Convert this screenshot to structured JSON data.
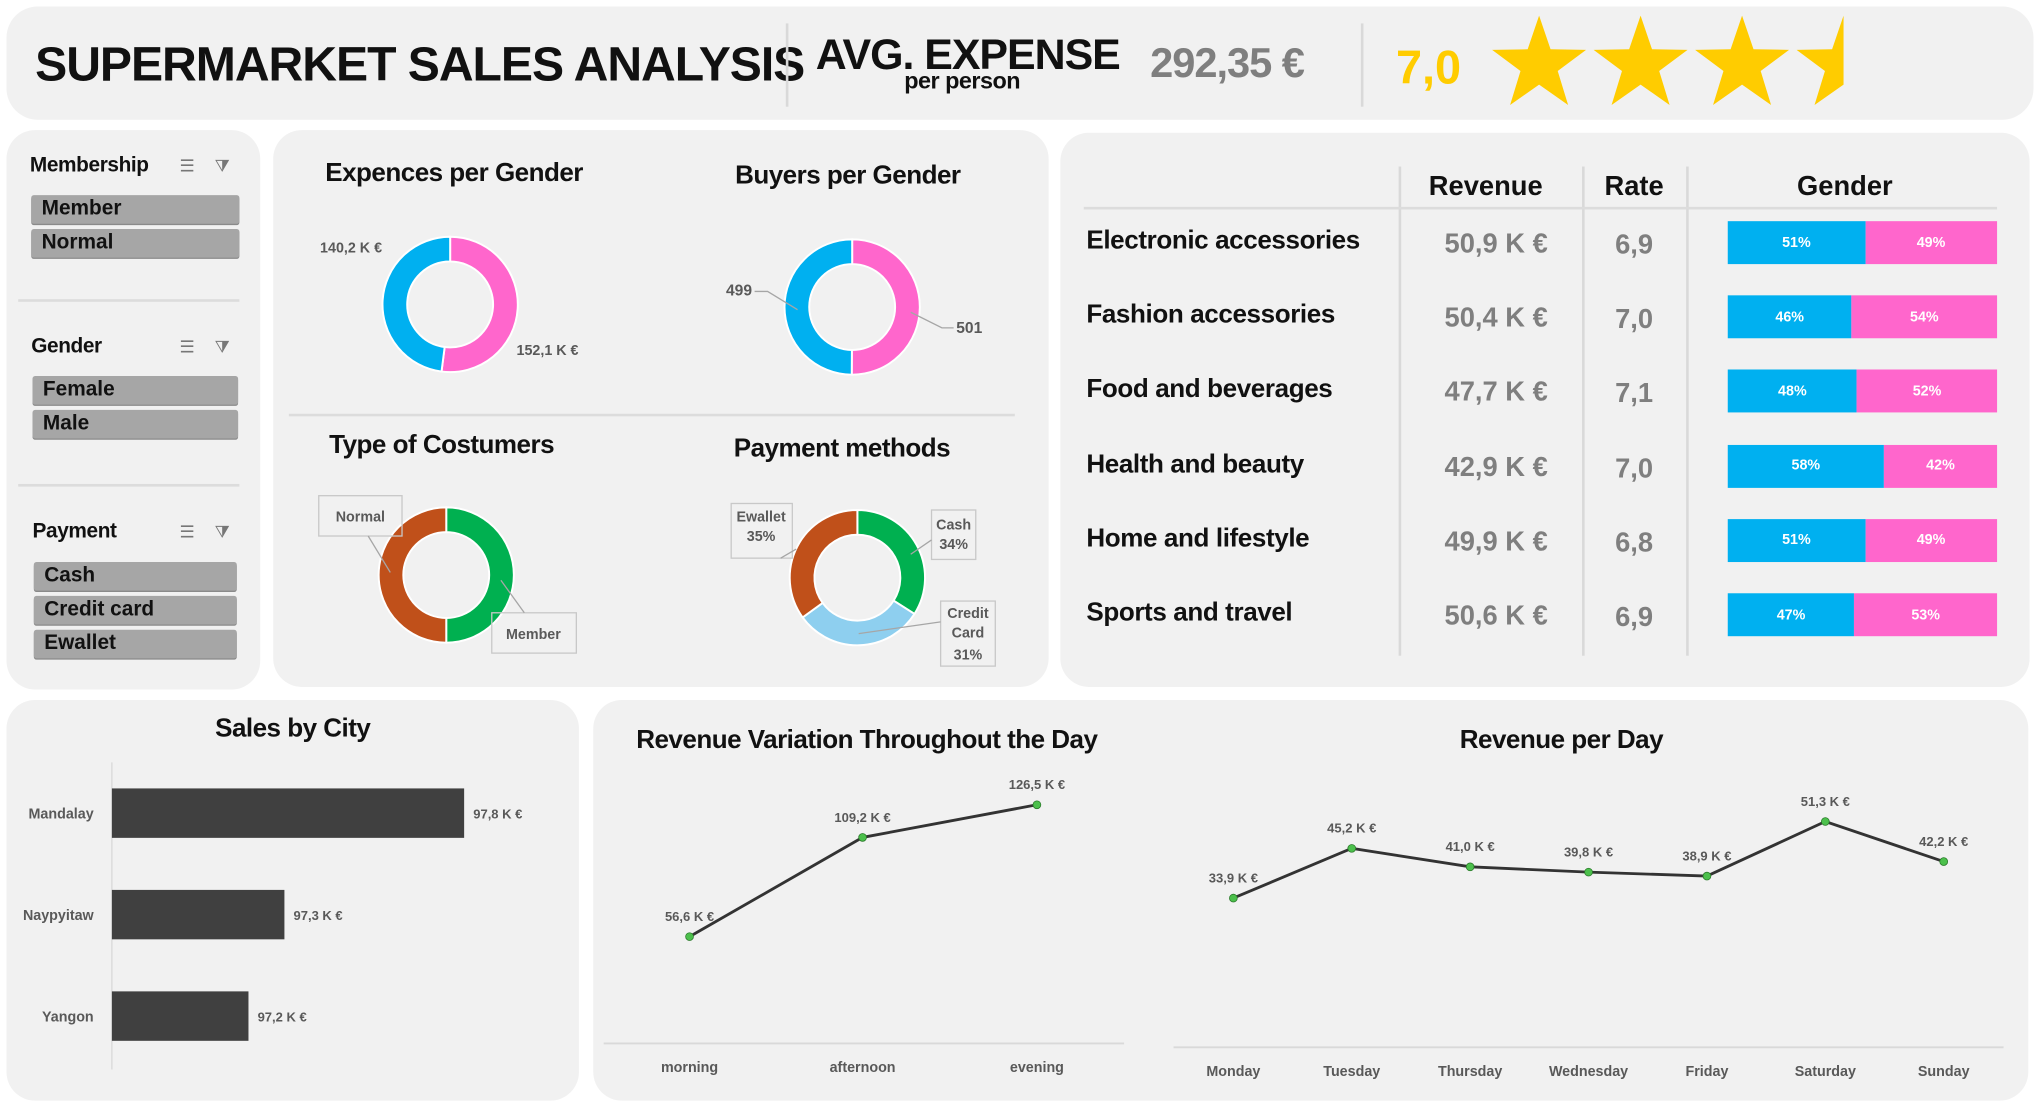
{
  "header": {
    "title": "SUPERMARKET SALES ANALYSIS",
    "avg_expense_label": "AVG. EXPENSE",
    "avg_expense_sub": "per person",
    "avg_expense_value": "292,35 €",
    "rating_value": "7,0",
    "stars_filled": 3.5,
    "stars_total": 5,
    "rating_color": "#FFCC00"
  },
  "filters": [
    {
      "title": "Membership",
      "items": [
        "Member",
        "Normal"
      ]
    },
    {
      "title": "Gender",
      "items": [
        "Female",
        "Male"
      ]
    },
    {
      "title": "Payment",
      "items": [
        "Cash",
        "Credit card",
        "Ewallet"
      ]
    }
  ],
  "colors": {
    "male": "#00B0F0",
    "female": "#FF66CC",
    "member": "#00B050",
    "normal": "#C0501A",
    "credit": "#8ECFEF",
    "dark": "#404040",
    "point": "#4CC04C"
  },
  "category_table": {
    "headers": [
      "",
      "Revenue",
      "Rate",
      "Gender"
    ],
    "rows": [
      {
        "category": "Electronic accessories",
        "revenue": "50,9 K €",
        "rate": "6,9",
        "male": "51%",
        "female": "49%",
        "male_pct": 51
      },
      {
        "category": "Fashion accessories",
        "revenue": "50,4 K €",
        "rate": "7,0",
        "male": "46%",
        "female": "54%",
        "male_pct": 46
      },
      {
        "category": "Food and beverages",
        "revenue": "47,7 K €",
        "rate": "7,1",
        "male": "48%",
        "female": "52%",
        "male_pct": 48
      },
      {
        "category": "Health and beauty",
        "revenue": "42,9 K €",
        "rate": "7,0",
        "male": "58%",
        "female": "42%",
        "male_pct": 58
      },
      {
        "category": "Home and lifestyle",
        "revenue": "49,9 K €",
        "rate": "6,8",
        "male": "51%",
        "female": "49%",
        "male_pct": 51
      },
      {
        "category": "Sports and travel",
        "revenue": "50,6 K €",
        "rate": "6,9",
        "male": "47%",
        "female": "53%",
        "male_pct": 47
      }
    ]
  },
  "chart_data": [
    {
      "id": "expenses",
      "type": "pie",
      "title": "Expences per Gender",
      "slices": [
        {
          "name": "Female",
          "value": 152.1,
          "label": "152,1 K €",
          "color": "#FF66CC"
        },
        {
          "name": "Male",
          "value": 140.2,
          "label": "140,2 K €",
          "color": "#00B0F0"
        }
      ]
    },
    {
      "id": "buyers",
      "type": "pie",
      "title": "Buyers per Gender",
      "slices": [
        {
          "name": "Female",
          "value": 501,
          "label": "501",
          "color": "#FF66CC"
        },
        {
          "name": "Male",
          "value": 499,
          "label": "499",
          "color": "#00B0F0"
        }
      ]
    },
    {
      "id": "customers",
      "type": "pie",
      "title": "Type of Costumers",
      "slices": [
        {
          "name": "Member",
          "value": 50,
          "label": "Member",
          "color": "#00B050"
        },
        {
          "name": "Normal",
          "value": 50,
          "label": "Normal",
          "color": "#C0501A"
        }
      ]
    },
    {
      "id": "payment",
      "type": "pie",
      "title": "Payment methods",
      "slices": [
        {
          "name": "Cash",
          "value": 34,
          "label": "Cash 34%",
          "color": "#00B050"
        },
        {
          "name": "Credit Card",
          "value": 31,
          "label": "Credit Card 31%",
          "color": "#8ECFEF"
        },
        {
          "name": "Ewallet",
          "value": 35,
          "label": "Ewallet 35%",
          "color": "#C0501A"
        }
      ]
    },
    {
      "id": "city",
      "type": "bar",
      "orientation": "horizontal",
      "title": "Sales by City",
      "categories": [
        "Mandalay",
        "Naypyitaw",
        "Yangon"
      ],
      "values": [
        97.8,
        97.3,
        97.2
      ],
      "labels": [
        "97,8 K €",
        "97,3 K €",
        "97,2 K €"
      ],
      "xlim": [
        96.82,
        98.0
      ]
    },
    {
      "id": "timeofday",
      "type": "line",
      "title": "Revenue Variation Throughout the Day",
      "x": [
        "morning",
        "afternoon",
        "evening"
      ],
      "values": [
        56.6,
        109.2,
        126.5
      ],
      "labels": [
        "56,6 K €",
        "109,2 K €",
        "126,5 K €"
      ],
      "ylim": [
        0,
        140
      ]
    },
    {
      "id": "perday",
      "type": "line",
      "title": "Revenue per Day",
      "x": [
        "Monday",
        "Tuesday",
        "Thursday",
        "Wednesday",
        "Friday",
        "Saturday",
        "Sunday"
      ],
      "values": [
        33.9,
        45.2,
        41.0,
        39.8,
        38.9,
        51.3,
        42.2
      ],
      "labels": [
        "33,9 K €",
        "45,2 K €",
        "41,0 K €",
        "39,8 K €",
        "38,9 K €",
        "51,3 K €",
        "42,2 K €"
      ],
      "ylim": [
        0,
        60
      ]
    }
  ]
}
